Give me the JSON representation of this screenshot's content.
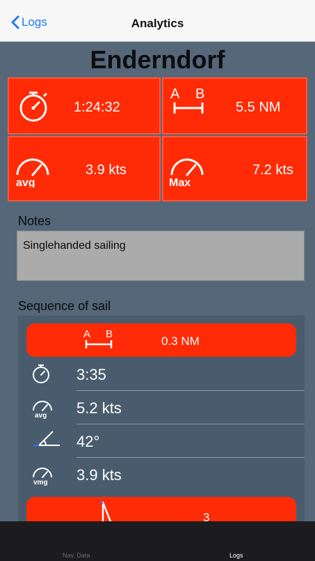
{
  "nav": {
    "back_label": "Logs",
    "title": "Analytics"
  },
  "place": "Enderndorf",
  "stats": {
    "duration": "1:24:32",
    "distance": "5.5 NM",
    "avg_speed": "3.9 kts",
    "max_speed": "7.2 kts",
    "distance_icon_a": "A",
    "distance_icon_b": "B",
    "avg_icon_label": "avg",
    "max_icon_label": "Max"
  },
  "notes": {
    "label": "Notes",
    "text": "Singlehanded sailing"
  },
  "sequence": {
    "label": "Sequence of sail",
    "leg": {
      "distance": "0.3 NM",
      "icon_a": "A",
      "icon_b": "B",
      "duration": "3:35",
      "avg_speed": "5.2 kts",
      "angle": "42°",
      "vmg_speed": "3.9 kts",
      "avg_icon_label": "avg",
      "vmg_icon_label": "vmg"
    },
    "next": {
      "value": "3"
    }
  },
  "tabs": {
    "nav_data": "Nav. Data",
    "logs": "Logs"
  },
  "colors": {
    "accent_red": "#ff2b06",
    "link_blue": "#1d7bf0",
    "background": "#556779"
  }
}
